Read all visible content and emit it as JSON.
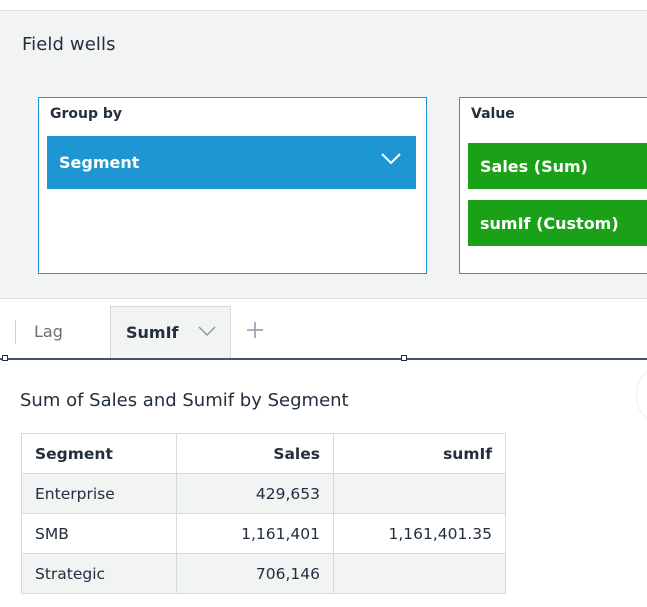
{
  "field_wells": {
    "title": "Field wells",
    "group_by": {
      "label": "Group by",
      "field": "Segment",
      "color": "#1d96d3"
    },
    "value": {
      "label": "Value",
      "fields": [
        "Sales (Sum)",
        "sumIf (Custom)"
      ],
      "color": "#1aa118"
    }
  },
  "tabs": {
    "items": [
      {
        "label": "Lag",
        "active": false
      },
      {
        "label": "SumIf",
        "active": true
      }
    ],
    "add_icon": "plus-icon"
  },
  "visual": {
    "title": "Sum of Sales and Sumif by Segment",
    "columns": [
      "Segment",
      "Sales",
      "sumIf"
    ],
    "rows": [
      [
        "Enterprise",
        "429,653",
        ""
      ],
      [
        "SMB",
        "1,161,401",
        "1,161,401.35"
      ],
      [
        "Strategic",
        "706,146",
        ""
      ]
    ]
  }
}
